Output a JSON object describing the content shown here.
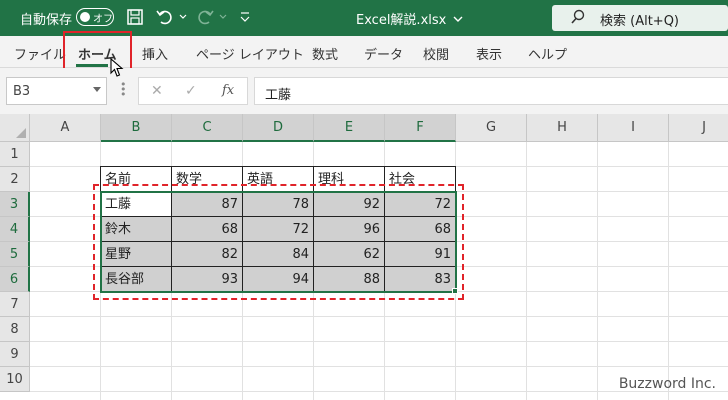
{
  "titlebar": {
    "autosave_label": "自動保存",
    "autosave_toggle": "オフ",
    "filename": "Excel解説.xlsx",
    "search_placeholder": "検索 (Alt+Q)"
  },
  "ribbon": {
    "tabs": [
      "ファイル",
      "ホーム",
      "挿入",
      "ページ レイアウト",
      "数式",
      "データ",
      "校閲",
      "表示",
      "ヘルプ"
    ],
    "active_tab": "ホーム"
  },
  "formula_bar": {
    "name_box": "B3",
    "formula": "工藤"
  },
  "grid": {
    "columns": [
      "A",
      "B",
      "C",
      "D",
      "E",
      "F",
      "G",
      "H",
      "I",
      "J"
    ],
    "rows": [
      "1",
      "2",
      "3",
      "4",
      "5",
      "6",
      "7",
      "8",
      "9",
      "10"
    ],
    "table": {
      "headers": [
        "名前",
        "数学",
        "英語",
        "理科",
        "社会"
      ],
      "rows": [
        [
          "工藤",
          "87",
          "78",
          "92",
          "72"
        ],
        [
          "鈴木",
          "68",
          "72",
          "96",
          "68"
        ],
        [
          "星野",
          "82",
          "84",
          "62",
          "91"
        ],
        [
          "長谷部",
          "93",
          "94",
          "88",
          "83"
        ]
      ]
    }
  },
  "watermark": "Buzzword Inc.",
  "colors": {
    "excel_green": "#217346",
    "highlight_red": "#e0242a",
    "selection_gray": "#d0d0d0"
  }
}
